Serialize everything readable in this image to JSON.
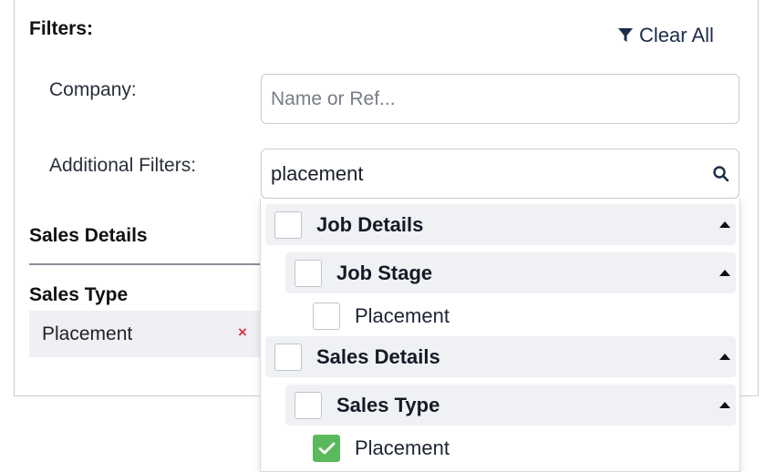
{
  "filters": {
    "title": "Filters:",
    "clear_all_label": "Clear All",
    "clear_all_icon": "filter-icon",
    "company": {
      "label": "Company:",
      "placeholder": "Name or Ref...",
      "value": ""
    },
    "additional": {
      "label": "Additional Filters:",
      "value": "placement",
      "icon": "search-icon"
    }
  },
  "sales_details": {
    "title": "Sales Details",
    "sales_type_title": "Sales Type",
    "chip_label": "Placement",
    "chip_remove": "×"
  },
  "dropdown": {
    "job_details": {
      "label": "Job Details",
      "checked": false
    },
    "job_stage": {
      "label": "Job Stage",
      "checked": false
    },
    "job_stage_placement": {
      "label": "Placement",
      "checked": false
    },
    "sales_details": {
      "label": "Sales Details",
      "checked": false
    },
    "sales_type": {
      "label": "Sales Type",
      "checked": false
    },
    "sales_type_placement": {
      "label": "Placement",
      "checked": true
    }
  },
  "colors": {
    "checked": "#5cb85c",
    "remove": "#e0313e",
    "group_bg": "#f0f1f4"
  }
}
